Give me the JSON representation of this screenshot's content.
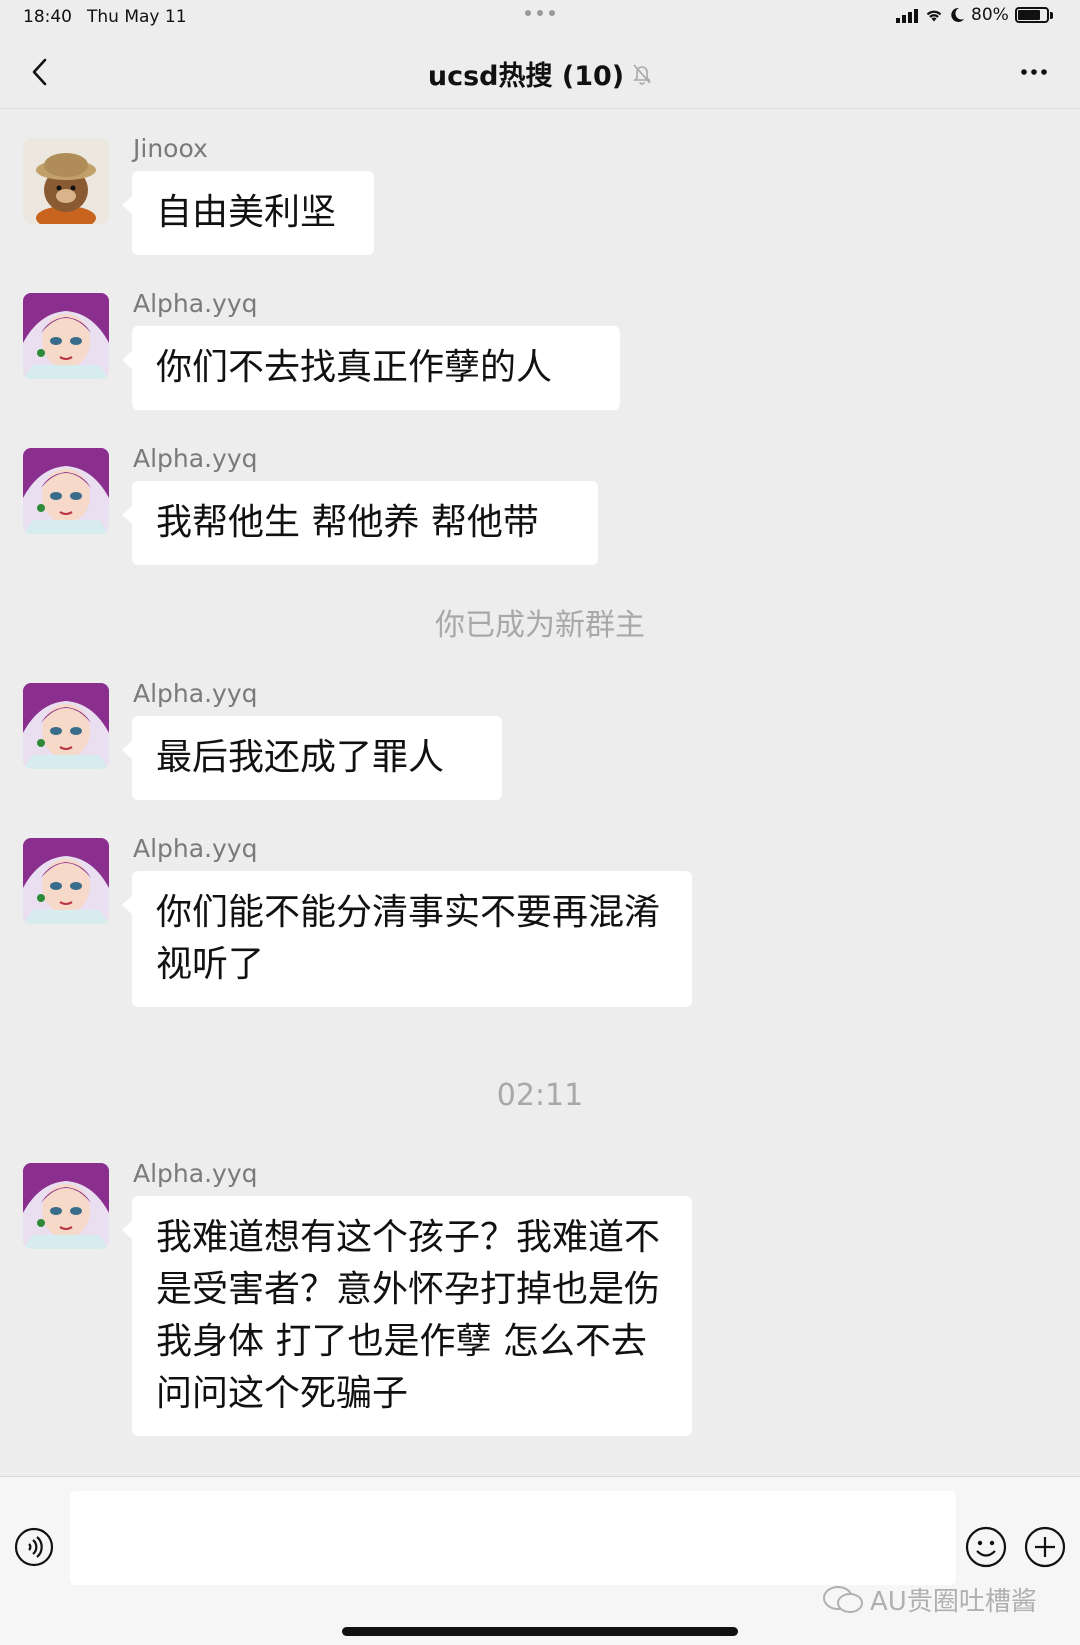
{
  "status_bar": {
    "time": "18:40",
    "date": "Thu May 11",
    "battery": "80%",
    "battery_level": 0.8
  },
  "header": {
    "title": "ucsd热搜 (10)",
    "icons": [
      "back-chevron-icon",
      "mute-bell-icon",
      "more-icon"
    ]
  },
  "messages": [
    {
      "sender": "Jinoox",
      "text": "自由美利坚",
      "avatar": "bear-avatar"
    },
    {
      "sender": "Alpha.yyq",
      "text": "你们不去找真正作孽的人",
      "avatar": "anime-avatar"
    },
    {
      "sender": "Alpha.yyq",
      "text": "我帮他生 帮他养 帮他带",
      "avatar": "anime-avatar"
    },
    {
      "sender": "Alpha.yyq",
      "text": "最后我还成了罪人",
      "avatar": "anime-avatar"
    },
    {
      "sender": "Alpha.yyq",
      "text": "你们能不能分清事实不要再混淆视听了",
      "avatar": "anime-avatar"
    },
    {
      "sender": "Alpha.yyq",
      "text": "我难道想有这个孩子？我难道不是受害者？意外怀孕打掉也是伤我身体 打了也是作孽 怎么不去问问这个死骗子",
      "avatar": "anime-avatar"
    }
  ],
  "system_notices": {
    "new_owner": "你已成为新群主",
    "timestamp": "02:11"
  },
  "input_bar": {
    "icons": [
      "voice-icon",
      "emoji-icon",
      "plus-icon"
    ],
    "input_value": ""
  },
  "watermark": "AU贵圈吐槽酱",
  "colors": {
    "background": "#ededed",
    "bubble": "#ffffff",
    "sender_text": "#7a7a7a",
    "system_text": "#a8a8a8"
  }
}
